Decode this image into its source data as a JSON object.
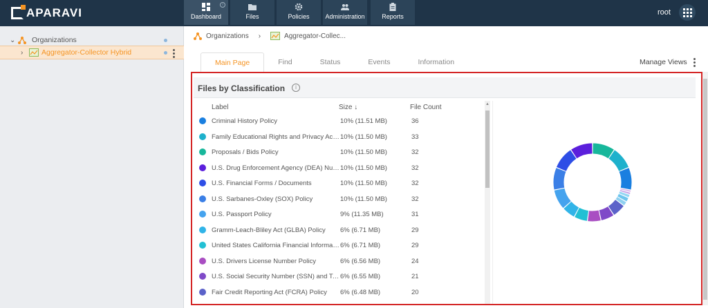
{
  "brand": {
    "name": "APARAVI"
  },
  "nav": [
    {
      "label": "Dashboard",
      "icon": "dashboard-icon",
      "active": true
    },
    {
      "label": "Files",
      "icon": "folder-icon"
    },
    {
      "label": "Policies",
      "icon": "gear-icon"
    },
    {
      "label": "Administration",
      "icon": "users-icon"
    },
    {
      "label": "Reports",
      "icon": "clipboard-icon"
    }
  ],
  "user": {
    "name": "root"
  },
  "sidebar": {
    "items": [
      {
        "label": "Organizations",
        "icon": "org-icon"
      },
      {
        "label": "Aggregator-Collector Hybrid",
        "icon": "aggregator-icon"
      }
    ]
  },
  "breadcrumb": {
    "root": "Organizations",
    "current": "Aggregator-Collec..."
  },
  "tabs": [
    "Main Page",
    "Find",
    "Status",
    "Events",
    "Information"
  ],
  "manage_views": "Manage Views",
  "panel": {
    "title": "Files by Classification",
    "columns": {
      "label": "Label",
      "size": "Size",
      "size_sort": "↓",
      "count": "File Count"
    }
  },
  "colors": {
    "accent": "#f59423",
    "topbar": "#1f3448",
    "highlight_border": "#d42525"
  },
  "chart_data": {
    "type": "pie",
    "rows": [
      {
        "label": "Criminal History Policy",
        "size": "10% (11.51 MB)",
        "count": 36,
        "color": "#1a7fe0"
      },
      {
        "label": "Family Educational Rights and Privacy Act (FERPA)",
        "size": "10% (11.50 MB)",
        "count": 33,
        "color": "#1eb1cc"
      },
      {
        "label": "Proposals / Bids Policy",
        "size": "10% (11.50 MB)",
        "count": 32,
        "color": "#17b79b"
      },
      {
        "label": "U.S. Drug Enforcement Agency (DEA) Number Policy",
        "size": "10% (11.50 MB)",
        "count": 32,
        "color": "#5b1fdc"
      },
      {
        "label": "U.S. Financial Forms / Documents",
        "size": "10% (11.50 MB)",
        "count": 32,
        "color": "#2e4ee6"
      },
      {
        "label": "U.S. Sarbanes-Oxley (SOX) Policy",
        "size": "10% (11.50 MB)",
        "count": 32,
        "color": "#3b7fe6"
      },
      {
        "label": "U.S. Passport Policy",
        "size": "9% (11.35 MB)",
        "count": 31,
        "color": "#45a3ee"
      },
      {
        "label": "Gramm-Leach-Bliley Act (GLBA) Policy",
        "size": "6% (6.71 MB)",
        "count": 29,
        "color": "#31b4e8"
      },
      {
        "label": "United States California Financial Information Privacy Act",
        "size": "6% (6.71 MB)",
        "count": 29,
        "color": "#22c0d4"
      },
      {
        "label": "U.S. Drivers License Number Policy",
        "size": "6% (6.56 MB)",
        "count": 24,
        "color": "#a94ec2"
      },
      {
        "label": "U.S. Social Security Number (SSN) and Taxpayer ID",
        "size": "6% (6.55 MB)",
        "count": 21,
        "color": "#7f4ac8"
      },
      {
        "label": "Fair Credit Reporting Act (FCRA) Policy",
        "size": "6% (6.48 MB)",
        "count": 20,
        "color": "#5b62c9"
      }
    ],
    "slices": [
      {
        "value": 10,
        "color": "#17b79b"
      },
      {
        "value": 10,
        "color": "#1eb1cc"
      },
      {
        "value": 10,
        "color": "#1a7fe0"
      },
      {
        "value": 1,
        "color": "#d7b4e8"
      },
      {
        "value": 1,
        "color": "#c39ce6"
      },
      {
        "value": 1.5,
        "color": "#93d6f3"
      },
      {
        "value": 2,
        "color": "#6dc5ee"
      },
      {
        "value": 2,
        "color": "#8fd0f0"
      },
      {
        "value": 6,
        "color": "#5b62c9"
      },
      {
        "value": 6,
        "color": "#7f4ac8"
      },
      {
        "value": 6,
        "color": "#a94ec2"
      },
      {
        "value": 6,
        "color": "#22c0d4"
      },
      {
        "value": 6,
        "color": "#31b4e8"
      },
      {
        "value": 9,
        "color": "#45a3ee"
      },
      {
        "value": 10,
        "color": "#3b7fe6"
      },
      {
        "value": 10,
        "color": "#2e4ee6"
      },
      {
        "value": 10,
        "color": "#5b1fdc"
      }
    ]
  }
}
